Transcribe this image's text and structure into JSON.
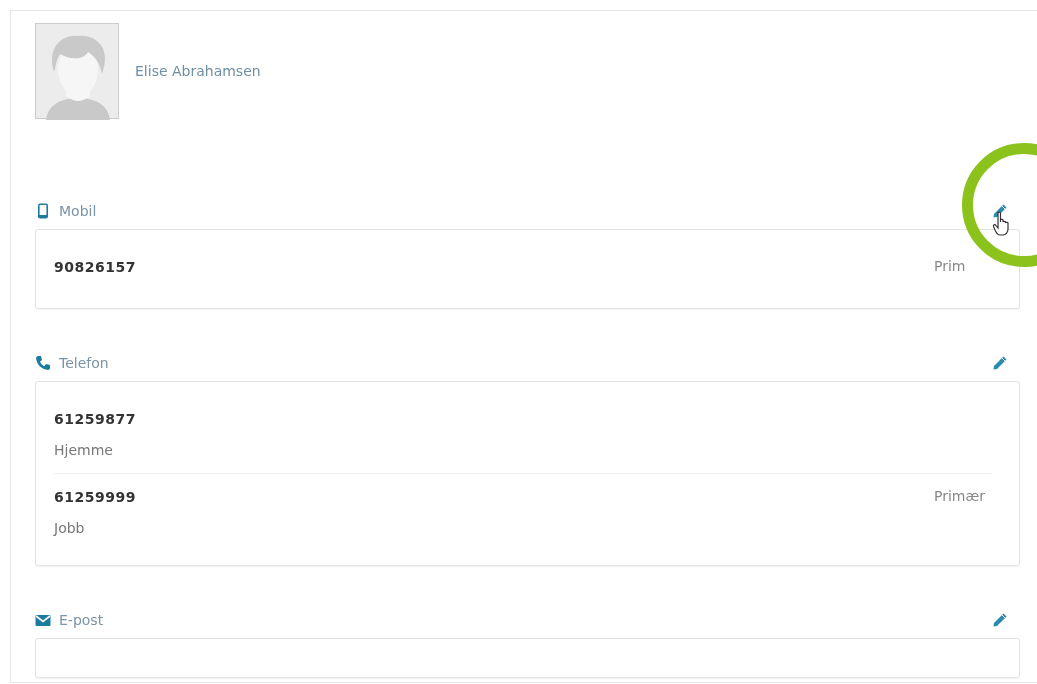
{
  "contact": {
    "name": "Elise Abrahamsen"
  },
  "sections": [
    {
      "kind": "mobile",
      "title": "Mobil",
      "highlighted": true,
      "entries": [
        {
          "number": "90826157",
          "tag": "Prim"
        }
      ]
    },
    {
      "kind": "phone",
      "title": "Telefon",
      "highlighted": false,
      "entries": [
        {
          "number": "61259877",
          "label": "Hjemme"
        },
        {
          "number": "61259999",
          "label": "Jobb",
          "tag": "Primær"
        }
      ]
    },
    {
      "kind": "email",
      "title": "E-post",
      "highlighted": false
    }
  ]
}
